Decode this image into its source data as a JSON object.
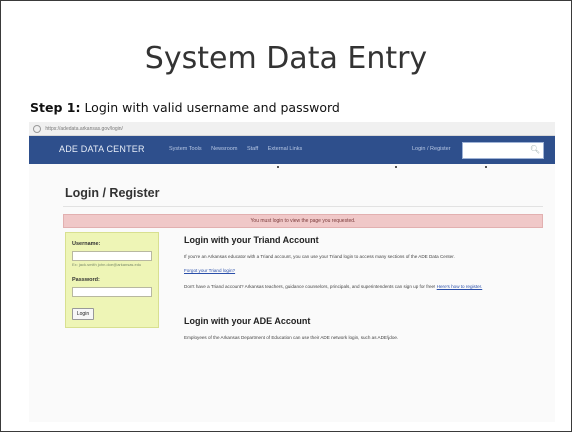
{
  "slide": {
    "title": "System Data Entry",
    "step_prefix": "Step 1:",
    "step_text": "Login with valid username and password"
  },
  "browser": {
    "url": "https://adedata.arkansas.gov/login/"
  },
  "navbar": {
    "brand": "ADE DATA CENTER",
    "links": [
      "System Tools",
      "Newsroom",
      "Staff",
      "External Links"
    ],
    "login_register": "Login / Register",
    "search_icon": "search-icon"
  },
  "page": {
    "title": "Login / Register",
    "alert": "You must login to view the page you requested.",
    "login_box": {
      "username_label": "Username:",
      "username_hint": "Ex: jack.smith  john.doe@arkansas.edu",
      "password_label": "Password:",
      "login_button": "Login"
    },
    "triand": {
      "heading": "Login with your Triand Account",
      "text": "If you're an Arkansas educator with a Triand account, you can use your Triand login to access many sections of the ADE Data Center.",
      "forgot": "Forgot your Triand login?",
      "signup_text": "Don't have a Triand account? Arkansas teachers, guidance counselors, principals, and superintendents can sign up for free!",
      "signup_link": "Here's how to register."
    },
    "ade": {
      "heading": "Login with your ADE Account",
      "text": "Employees of the Arkansas Department of Education can use their ADE network login, such as ADE\\jdoe."
    }
  }
}
